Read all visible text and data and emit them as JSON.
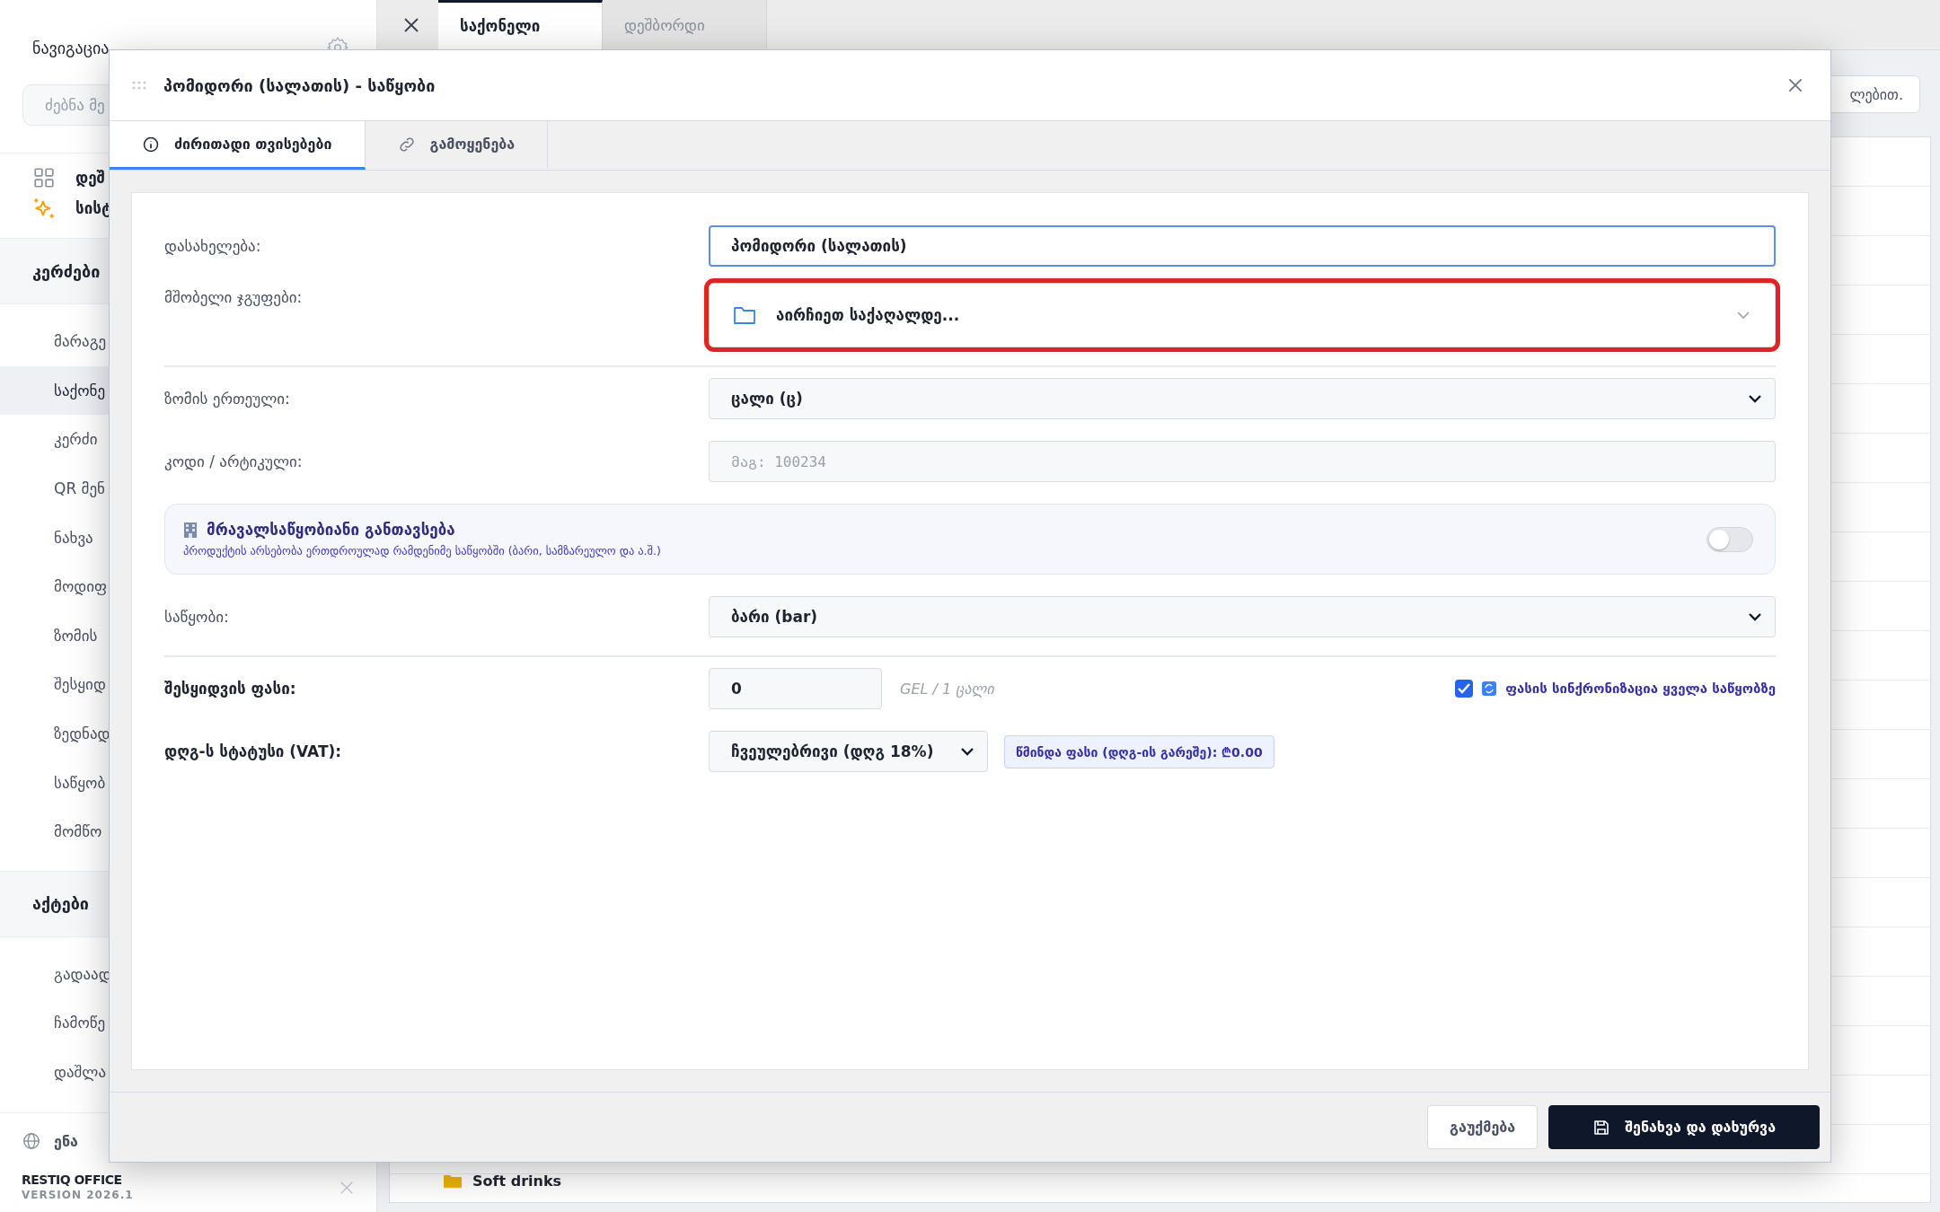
{
  "sidebar": {
    "title": "ნავიგაცია",
    "search": {
      "placeholder": "ძებნა მე"
    },
    "top_items": [
      {
        "label": "დეშ",
        "kind": "grid"
      },
      {
        "label": "სისტ",
        "kind": "sparkle"
      }
    ],
    "sections": [
      {
        "title": "კერძები",
        "items": [
          {
            "label": "მარაგე",
            "selected": false
          },
          {
            "label": "საქონე",
            "selected": true
          },
          {
            "label": "კერძი",
            "selected": false
          },
          {
            "label": "QR მენ",
            "selected": false
          },
          {
            "label": "ნახვა",
            "selected": false
          },
          {
            "label": "მოდიფ",
            "selected": false
          },
          {
            "label": "ზომის",
            "selected": false
          },
          {
            "label": "შესყიდ",
            "selected": false
          },
          {
            "label": "ზედნად",
            "selected": false
          },
          {
            "label": "საწყობ",
            "selected": false
          },
          {
            "label": "მომწო",
            "selected": false
          }
        ]
      },
      {
        "title": "აქტები",
        "items": [
          {
            "label": "გადაად",
            "selected": false
          },
          {
            "label": "ჩამოწე",
            "selected": false
          },
          {
            "label": "დაშლა",
            "selected": false
          }
        ]
      }
    ],
    "language": "ენა",
    "brand": "RESTIQ OFFICE",
    "version": "VERSION 2026.1"
  },
  "tabs": [
    {
      "label": "საქონელი",
      "selected": true
    },
    {
      "label": "დეშბორდი",
      "selected": false
    }
  ],
  "toolbar_button": "ლებით.",
  "background_rows": [
    {
      "label": "Soft drinks"
    }
  ],
  "dialog": {
    "title": "პომიდორი (სალათის) - საწყობი",
    "tabs": [
      {
        "label": "ძირითადი თვისებები",
        "kind": "info",
        "selected": true
      },
      {
        "label": "გამოყენება",
        "kind": "link",
        "selected": false
      }
    ],
    "fields": [
      {
        "kind": "input",
        "label": "დასახელება:",
        "value": "პომიდორი (სალათის)",
        "focused": true,
        "strong": false
      },
      {
        "kind": "picker",
        "label": "მშობელი ჯგუფები:",
        "placeholder": "აირჩიეთ საქაღალდე...",
        "highlighted": true,
        "strong": false
      },
      {
        "kind": "divider"
      },
      {
        "kind": "select",
        "label": "ზომის ერთეული:",
        "value": "ცალი (ც)",
        "strong": false
      },
      {
        "kind": "input",
        "label": "კოდი / არტიკული:",
        "placeholder": "მაგ: 100234",
        "focused": false,
        "strong": false
      },
      {
        "kind": "toggle",
        "title": "მრავალსაწყობიანი განთავსება",
        "description": "პროდუქტის არსებობა ერთდროულად რამდენიმე საწყობში (ბარი, სამზარეულო და ა.შ.)",
        "on": false
      },
      {
        "kind": "select",
        "label": "საწყობი:",
        "value": "ბარი (bar)",
        "strong": false
      },
      {
        "kind": "divider"
      },
      {
        "kind": "price",
        "label": "შესყიდვის ფასი:",
        "value": "0",
        "unit": "GEL / 1 ცალი",
        "sync_label": "ფასის სინქრონიზაცია ყველა საწყობზე",
        "checked": true,
        "strong": true
      },
      {
        "kind": "vat",
        "label": "დღგ-ს სტატუსი (VAT):",
        "value": "ჩვეულებრივი (დღგ 18%)",
        "net_price": "წმინდა ფასი (დღგ-ის გარეშე): ₾0.00",
        "strong": true
      }
    ],
    "buttons": [
      {
        "label": "გაუქმება",
        "kind": "secondary"
      },
      {
        "label": "შენახვა და დახურვა",
        "kind": "primary"
      }
    ]
  }
}
